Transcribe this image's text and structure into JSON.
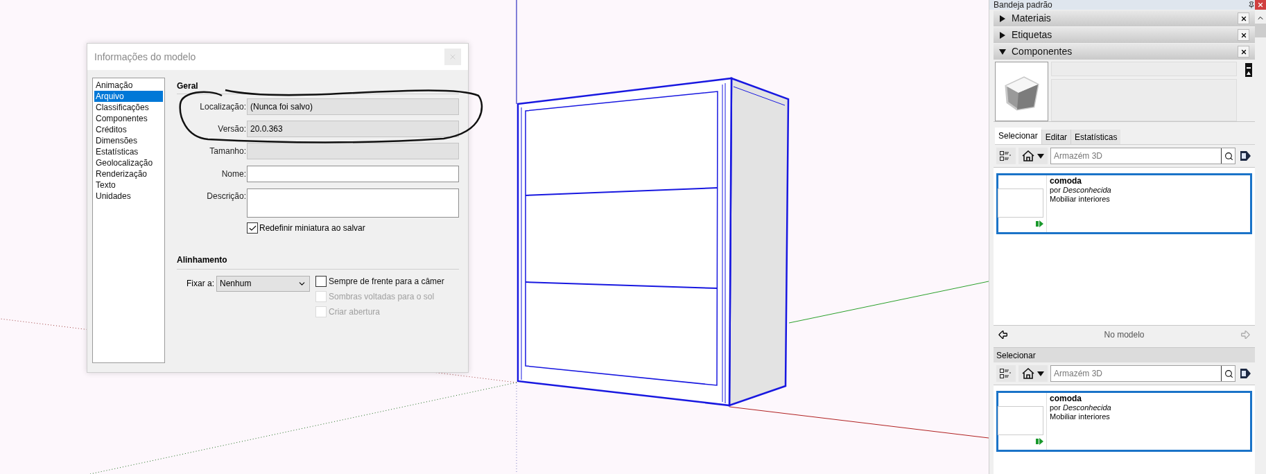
{
  "dialog": {
    "title": "Informações do modelo",
    "categories": [
      {
        "label": "Animação",
        "selected": false
      },
      {
        "label": "Arquivo",
        "selected": true
      },
      {
        "label": "Classificações",
        "selected": false
      },
      {
        "label": "Componentes",
        "selected": false
      },
      {
        "label": "Créditos",
        "selected": false
      },
      {
        "label": "Dimensões",
        "selected": false
      },
      {
        "label": "Estatísticas",
        "selected": false
      },
      {
        "label": "Geolocalização",
        "selected": false
      },
      {
        "label": "Renderização",
        "selected": false
      },
      {
        "label": "Texto",
        "selected": false
      },
      {
        "label": "Unidades",
        "selected": false
      }
    ],
    "general": {
      "heading": "Geral",
      "fields": [
        {
          "kind": "text",
          "label": "Localização:",
          "value": "(Nunca foi salvo)",
          "readonly": true
        },
        {
          "kind": "text",
          "label": "Versão:",
          "value": "20.0.363",
          "readonly": true
        },
        {
          "kind": "text",
          "label": "Tamanho:",
          "readonly": true
        },
        {
          "kind": "text",
          "label": "Nome:",
          "readonly": false
        },
        {
          "kind": "textarea",
          "label": "Descrição:",
          "readonly": false
        }
      ],
      "checkbox": {
        "label": "Redefinir miniatura ao salvar",
        "checked": true
      }
    },
    "alignment": {
      "heading": "Alinhamento",
      "select_label": "Fixar a:",
      "select_value": "Nenhum",
      "options": [
        {
          "label": "Sempre de frente para a câmer",
          "checked": false,
          "disabled": false
        },
        {
          "label": "Sombras voltadas para o sol",
          "checked": false,
          "disabled": true
        },
        {
          "label": "Criar abertura",
          "checked": false,
          "disabled": true
        }
      ]
    }
  },
  "tray": {
    "title": "Bandeja padrão",
    "panels": [
      {
        "label": "Materiais",
        "expanded": false
      },
      {
        "label": "Etiquetas",
        "expanded": false
      },
      {
        "label": "Componentes",
        "expanded": true
      }
    ],
    "tabs": [
      {
        "label": "Selecionar",
        "selected": true
      },
      {
        "label": "Editar",
        "selected": false
      },
      {
        "label": "Estatísticas",
        "selected": false
      }
    ],
    "search": {
      "placeholder": "Armazém 3D"
    },
    "items": [
      {
        "name": "comoda",
        "author": "por *Desconhecida*",
        "category": "Mobiliar interiores"
      }
    ],
    "nav_label": "No modelo",
    "second": {
      "heading": "Selecionar",
      "search": {
        "placeholder": "Armazém 3D"
      },
      "items": [
        {
          "name": "comoda",
          "author": "por *Desconhecida*",
          "category": "Mobiliar interiores"
        }
      ]
    }
  }
}
